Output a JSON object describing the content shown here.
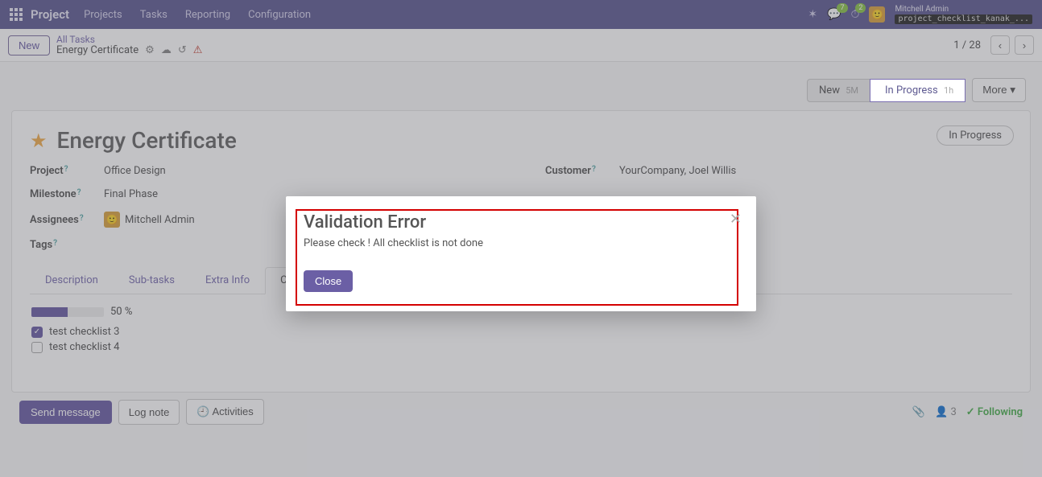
{
  "nav": {
    "app_title": "Project",
    "links": [
      "Projects",
      "Tasks",
      "Reporting",
      "Configuration"
    ],
    "chat_count": "7",
    "clock_count": "2",
    "user_name": "Mitchell Admin",
    "db_name": "project_checklist_kanak_..."
  },
  "cp": {
    "new": "New",
    "bc_top": "All Tasks",
    "bc_current": "Energy Certificate",
    "pager": "1 / 28"
  },
  "status": {
    "stages": [
      {
        "label": "New",
        "time": "5M"
      },
      {
        "label": "In Progress",
        "time": "1h"
      }
    ],
    "more": "More",
    "state_pill": "In Progress"
  },
  "task": {
    "title": "Energy Certificate",
    "fields_left": {
      "project_label": "Project",
      "project_value": "Office Design",
      "milestone_label": "Milestone",
      "milestone_value": "Final Phase",
      "assignees_label": "Assignees",
      "assignees_value": "Mitchell Admin",
      "tags_label": "Tags"
    },
    "fields_right": {
      "customer_label": "Customer",
      "customer_value": "YourCompany, Joel Willis"
    }
  },
  "tabs": {
    "items": [
      "Description",
      "Sub-tasks",
      "Extra Info",
      "Checkli"
    ],
    "checklist": {
      "progress_pct": "50 %",
      "progress_width": "50%",
      "items": [
        {
          "label": "test checklist 3",
          "checked": true
        },
        {
          "label": "test checklist 4",
          "checked": false
        }
      ]
    }
  },
  "chatter": {
    "send": "Send message",
    "log": "Log note",
    "activities": "Activities",
    "follower_count": "3",
    "following": "Following"
  },
  "modal": {
    "title": "Validation Error",
    "message": "Please check ! All checklist is not done",
    "close": "Close"
  }
}
